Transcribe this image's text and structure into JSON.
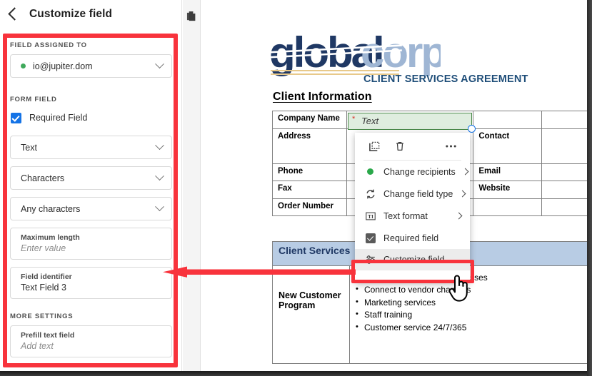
{
  "sidebar": {
    "back_icon": "chevron-left-icon",
    "title": "Customize field",
    "sections": {
      "assigned_label": "FIELD ASSIGNED TO",
      "recipient_value": "io@jupiter.dom",
      "form_field_label": "FORM FIELD",
      "required_field_label": "Required Field",
      "field_type_value": "Text",
      "validation_value": "Characters",
      "character_rule_value": "Any characters",
      "max_length_label": "Maximum length",
      "max_length_placeholder": "Enter value",
      "identifier_label": "Field identifier",
      "identifier_value": "Text Field 3",
      "more_settings_label": "MORE SETTINGS",
      "prefill_label": "Prefill text field",
      "prefill_placeholder": "Add text"
    }
  },
  "rail": {
    "pages_icon": "pages-icon"
  },
  "document": {
    "logo_part1": "global",
    "logo_part2": "corp",
    "tagline": "CLIENT SERVICES AGREEMENT",
    "section_heading": "Client Information",
    "client_table": [
      {
        "label": "Company Name",
        "right_label": ""
      },
      {
        "label": "Address",
        "right_label": "Contact"
      },
      {
        "label": "Phone",
        "right_label": "Email"
      },
      {
        "label": "Fax",
        "right_label": "Website"
      },
      {
        "label": "Order Number",
        "right_label": ""
      }
    ],
    "services_heading": "Client Services",
    "services_row_label": "New Customer Program",
    "services_bullets": [
      "Set up properties and processes",
      "Connect to vendor channels",
      "Marketing services",
      "Staff training",
      "Customer service 24/7/365"
    ],
    "form_field": {
      "required_marker": "*",
      "placeholder": "Text"
    }
  },
  "context_menu": {
    "toolbar": [
      {
        "name": "duplicate-icon",
        "label": "Duplicate"
      },
      {
        "name": "delete-icon",
        "label": "Delete"
      },
      {
        "name": "more-options-icon",
        "label": "More options"
      }
    ],
    "items": [
      {
        "icon": "recipient-dot-icon",
        "label": "Change recipients",
        "submenu": true
      },
      {
        "icon": "refresh-icon",
        "label": "Change field type",
        "submenu": true
      },
      {
        "icon": "text-format-icon",
        "label": "Text format",
        "submenu": true
      },
      {
        "icon": "checkbox-checked-icon",
        "label": "Required field",
        "submenu": false
      },
      {
        "icon": "sliders-icon",
        "label": "Customize field",
        "submenu": false
      }
    ]
  },
  "annotations": {
    "highlight_color": "#f8333c",
    "arrow_name": "red-arrow-pointing-to-sidebar"
  },
  "colors": {
    "accent_blue": "#1473e6",
    "logo_navy": "#1f3864",
    "logo_light_blue": "#9fb6d4",
    "field_green_bg": "#dfeddf",
    "field_green_border": "#4a8a4a",
    "required_star_red": "#d93025",
    "table_header_blue": "#b8cce4"
  }
}
